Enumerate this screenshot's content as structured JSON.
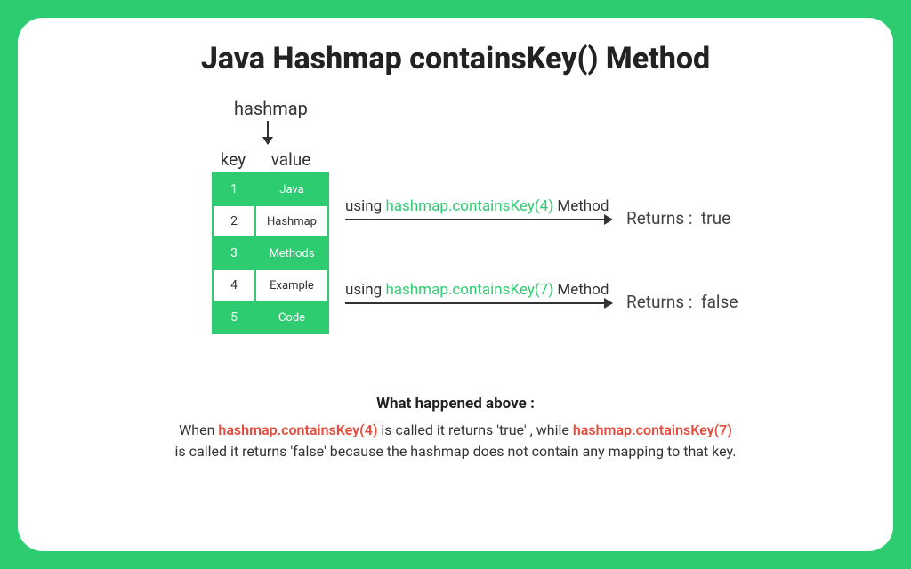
{
  "title": "Java Hashmap containsKey() Method",
  "diagram": {
    "hashmap_label": "hashmap",
    "key_header": "key",
    "value_header": "value",
    "rows": [
      {
        "key": "1",
        "value": "Java",
        "filled": true
      },
      {
        "key": "2",
        "value": "Hashmap",
        "filled": false
      },
      {
        "key": "3",
        "value": "Methods",
        "filled": true
      },
      {
        "key": "4",
        "value": "Example",
        "filled": false
      },
      {
        "key": "5",
        "value": "Code",
        "filled": true
      }
    ],
    "method1": {
      "prefix": "using ",
      "call": "hashmap.containsKey(4)",
      "suffix": " Method",
      "returns_label": "Returns :",
      "returns_value": "true"
    },
    "method2": {
      "prefix": "using ",
      "call": "hashmap.containsKey(7)",
      "suffix": " Method",
      "returns_label": "Returns :",
      "returns_value": "false"
    }
  },
  "explanation": {
    "header": "What happened above :",
    "pre": "When ",
    "call1": "hashmap.containsKey(4)",
    "mid": " is called it returns 'true' , while ",
    "call2": "hashmap.containsKey(7)",
    "post": "is called it returns 'false' because the hashmap does not contain any mapping to that key."
  }
}
